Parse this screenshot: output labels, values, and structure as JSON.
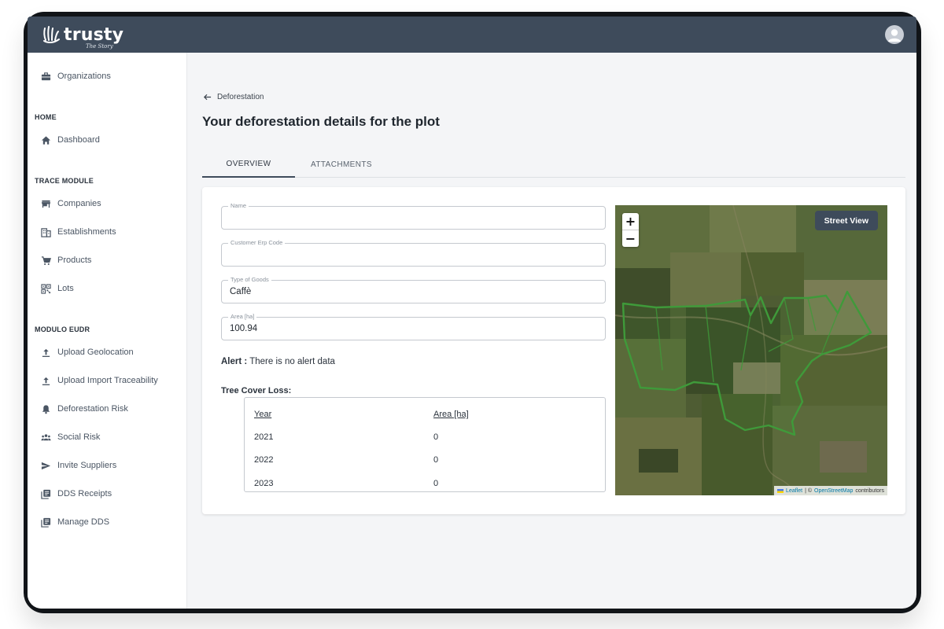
{
  "app": {
    "logo_text": "trusty",
    "logo_tagline": "The Story"
  },
  "sidebar": {
    "organizations": "Organizations",
    "sections": [
      {
        "title": "HOME",
        "items": [
          "Dashboard"
        ]
      },
      {
        "title": "TRACE MODULE",
        "items": [
          "Companies",
          "Establishments",
          "Products",
          "Lots"
        ]
      },
      {
        "title": "MODULO EUDR",
        "items": [
          "Upload Geolocation",
          "Upload Import Traceability",
          "Deforestation Risk",
          "Social Risk",
          "Invite Suppliers",
          "DDS Receipts",
          "Manage DDS"
        ]
      }
    ]
  },
  "breadcrumb": {
    "label": "Deforestation"
  },
  "page": {
    "title": "Your deforestation details for the plot"
  },
  "tabs": [
    {
      "label": "OVERVIEW",
      "active": true
    },
    {
      "label": "ATTACHMENTS",
      "active": false
    }
  ],
  "form": {
    "name": {
      "label": "Name",
      "value": ""
    },
    "customer_erp_code": {
      "label": "Customer Erp Code",
      "value": ""
    },
    "type_of_goods": {
      "label": "Type of Goods",
      "value": "Caffè"
    },
    "area": {
      "label": "Area [ha]",
      "value": "100.94"
    }
  },
  "alert": {
    "label": "Alert :",
    "text": "There is no alert data"
  },
  "tree_cover_loss": {
    "title": "Tree Cover Loss:",
    "columns": [
      "Year",
      "Area [ha]"
    ],
    "rows": [
      {
        "year": "2021",
        "area": "0"
      },
      {
        "year": "2022",
        "area": "0"
      },
      {
        "year": "2023",
        "area": "0"
      }
    ]
  },
  "map": {
    "zoom_in": "+",
    "zoom_out": "−",
    "street_view": "Street View",
    "attribution_leaflet": "Leaflet",
    "attribution_sep": "| ©",
    "attribution_osm": "OpenStreetMap",
    "attribution_contrib": "contributors",
    "polygon_color": "#3f9a3a"
  },
  "colors": {
    "topbar": "#3e4b5b",
    "accent": "#3e4b5b"
  }
}
